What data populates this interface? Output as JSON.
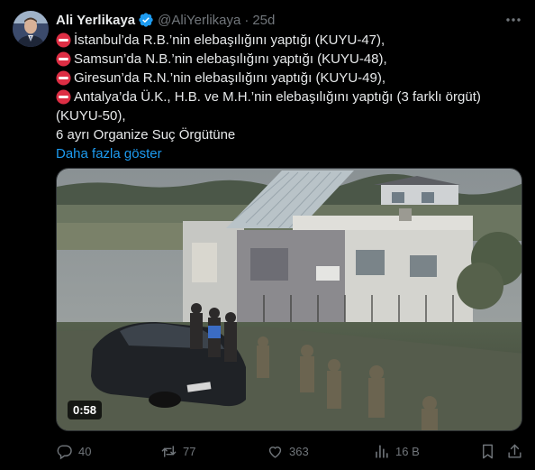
{
  "author": {
    "name": "Ali Yerlikaya",
    "handle": "@AliYerlikaya",
    "separator": "·",
    "time": "25d"
  },
  "icons": {
    "verified": "verified-badge-icon",
    "more": "more-icon",
    "stop": "no-entry-icon",
    "reply": "reply-icon",
    "repost": "repost-icon",
    "like": "like-icon",
    "views": "views-icon",
    "bookmark": "bookmark-icon",
    "share": "share-icon"
  },
  "colors": {
    "accent": "#1d9bf0",
    "muted": "#71767b",
    "stop_red": "#dd2e44"
  },
  "body": {
    "lines": [
      "İstanbul’da R.B.’nin elebaşılığını yaptığı (KUYU-47),",
      "Samsun’da N.B.’nin elebaşılığını yaptığı (KUYU-48),",
      "Giresun’da R.N.’nin elebaşılığını yaptığı (KUYU-49),",
      "Antalya’da Ü.K., H.B. ve M.H.’nin elebaşılığını yaptığı (3 farklı örgüt)",
      "(KUYU-50),",
      "6 ayrı Organize Suç Örgütüne"
    ],
    "show_more": "Daha fazla göster"
  },
  "media": {
    "duration": "0:58"
  },
  "actions": {
    "replies": "40",
    "reposts": "77",
    "likes": "363",
    "views": "16 B"
  }
}
